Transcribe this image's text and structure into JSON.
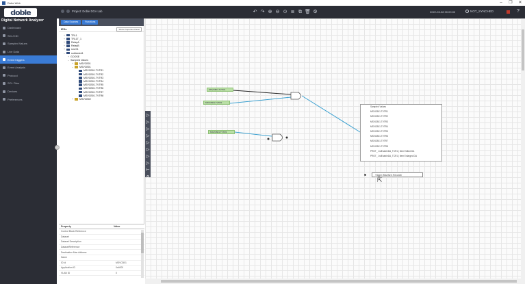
{
  "window": {
    "title": "Dobe Web",
    "controls": [
      "–",
      "❐",
      "✕"
    ]
  },
  "header": {
    "logo": "doble",
    "project_label": "Project: Doble DGA Lab",
    "toolbar_icons": [
      "undo-icon",
      "redo-icon",
      "zoom-in-icon",
      "zoom-out-icon",
      "zoom-fit-icon",
      "list-icon",
      "copy-icon",
      "delete-icon",
      "settings-icon"
    ],
    "toolbar_glyphs": [
      "↶",
      "↷",
      "⊕",
      "⊖",
      "⊙",
      "≣",
      "⧉",
      "🗑",
      "⚙"
    ],
    "datetime": "2022-03-08 00:00:00",
    "sync_status": "NOT_SYNCHED"
  },
  "app_subtitle": "Digital Network Analyzer",
  "sidebar": {
    "items": [
      {
        "label": "Dashboard",
        "active": false
      },
      {
        "label": "SCL/CID",
        "active": false
      },
      {
        "label": "Sampled Values",
        "active": false
      },
      {
        "label": "Live Data",
        "active": false
      },
      {
        "label": "Event triggers",
        "active": true
      },
      {
        "label": "Event Analysis",
        "active": false
      },
      {
        "label": "Protocol",
        "active": false
      },
      {
        "label": "SCL Files",
        "active": false
      },
      {
        "label": "Devices",
        "active": false
      },
      {
        "label": "Preferences",
        "active": false
      }
    ]
  },
  "panel": {
    "tabs": [
      "Data Sources",
      "Functions"
    ],
    "heading": "IEDs",
    "heading_button": "Show Properties Panel",
    "tree": [
      {
        "text": "TRL1",
        "level": 0,
        "toggle": "+",
        "icon": "ied"
      },
      {
        "text": "TRL1T_1",
        "level": 0,
        "toggle": "+",
        "icon": "ied"
      },
      {
        "text": "RelayA",
        "level": 0,
        "toggle": "+",
        "icon": "ied"
      },
      {
        "text": "RelayB",
        "level": 0,
        "toggle": "+",
        "icon": "ied"
      },
      {
        "text": "smv01",
        "level": 0,
        "toggle": "+",
        "icon": "ied"
      },
      {
        "text": "subtested1",
        "level": 0,
        "toggle": "–",
        "icon": "ied"
      },
      {
        "text": "GOOSE",
        "level": 1,
        "toggle": "+",
        "icon": ""
      },
      {
        "text": "Sampled Values",
        "level": 1,
        "toggle": "–",
        "icon": ""
      },
      {
        "text": "MSVCB01",
        "level": 2,
        "toggle": "+",
        "icon": "folder"
      },
      {
        "text": "MSVCB01",
        "level": 2,
        "toggle": "–",
        "icon": "folder"
      },
      {
        "text": "MSVCB01.TVTR1",
        "level": 3,
        "toggle": "",
        "icon": "ied"
      },
      {
        "text": "MSVCB01.TVTR2",
        "level": 3,
        "toggle": "",
        "icon": "ied"
      },
      {
        "text": "MSVCB01.TVTR3",
        "level": 3,
        "toggle": "",
        "icon": "ied"
      },
      {
        "text": "MSVCB01.TVTR4",
        "level": 3,
        "toggle": "",
        "icon": "ied"
      },
      {
        "text": "MSVCB01.TVTR5",
        "level": 3,
        "toggle": "",
        "icon": "ied"
      },
      {
        "text": "MSVCB01.TVTR6",
        "level": 3,
        "toggle": "",
        "icon": "ied"
      },
      {
        "text": "MSVCB01.TVTR7",
        "level": 3,
        "toggle": "",
        "icon": "ied"
      },
      {
        "text": "MSVCB01.TVTR8",
        "level": 3,
        "toggle": "",
        "icon": "ied"
      },
      {
        "text": "MSVCB02",
        "level": 2,
        "toggle": "+",
        "icon": "folder"
      }
    ]
  },
  "properties": {
    "headers": [
      "Property",
      "Value"
    ],
    "rows": [
      {
        "k": "Control Block Reference",
        "v": ""
      },
      {
        "k": "Dataset",
        "v": ""
      },
      {
        "k": "Dataset Description",
        "v": ""
      },
      {
        "k": "DatasetReference",
        "v": ""
      },
      {
        "k": "Destination Mac Address",
        "v": ""
      },
      {
        "k": "Name",
        "v": ""
      },
      {
        "k": "ID Id",
        "v": "MSVCB01"
      },
      {
        "k": "Application ID",
        "v": "0x4000"
      },
      {
        "k": "VLAN ID",
        "v": "0"
      }
    ]
  },
  "canvas": {
    "gate_tools": [
      "▷",
      "▷",
      "▷",
      "▷",
      "▷",
      "▷",
      "▷",
      "▷",
      "⊢",
      "⊘"
    ],
    "signals": [
      "MSVCB01.TVTR1",
      "MSVCB01.TVTR2",
      "MSVCB01.TVTR3"
    ],
    "output_items": [
      "Sampled Values",
      "MSVCB01.TVTR1",
      "MSVCB01.TVTR2",
      "MSVCB01.TVTR3",
      "MSVCB01.TVTR4",
      "MSVCB01.TVTR5",
      "MSVCB01.TVTR6",
      "MSVCB01.TVTR7",
      "MSVCB01.TVTR8",
      "PROT_ 1stEnableDA_TCR1 | Item Edited DA",
      "PROT_ 1stEnableDA_TCR1 | Item Enlarged DA"
    ],
    "trigger_label": "Trigger Waveform Recorder"
  }
}
